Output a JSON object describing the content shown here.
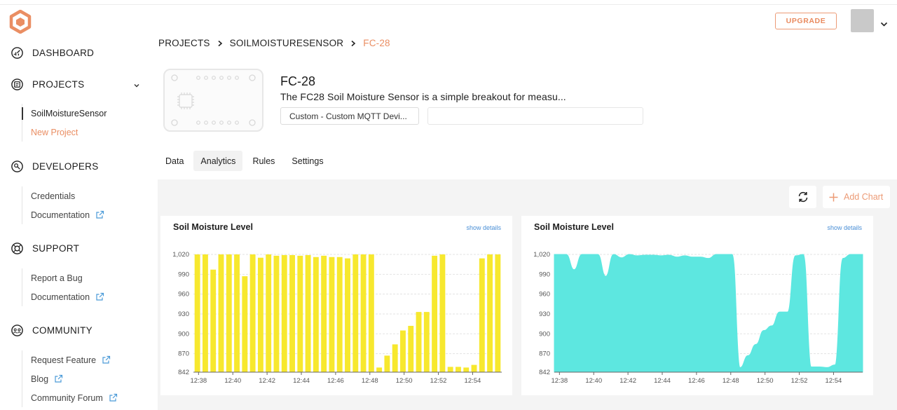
{
  "header": {
    "upgrade_label": "UPGRADE"
  },
  "sidebar": {
    "sections": [
      {
        "label": "DASHBOARD"
      },
      {
        "label": "PROJECTS",
        "items": [
          {
            "label": "SoilMoistureSensor"
          },
          {
            "label": "New Project"
          }
        ]
      },
      {
        "label": "DEVELOPERS",
        "items": [
          {
            "label": "Credentials"
          },
          {
            "label": "Documentation"
          }
        ]
      },
      {
        "label": "SUPPORT",
        "items": [
          {
            "label": "Report a Bug"
          },
          {
            "label": "Documentation"
          }
        ]
      },
      {
        "label": "COMMUNITY",
        "items": [
          {
            "label": "Request Feature"
          },
          {
            "label": "Blog"
          },
          {
            "label": "Community Forum"
          }
        ]
      }
    ]
  },
  "breadcrumb": [
    "PROJECTS",
    "SOILMOISTURESENSOR",
    "FC-28"
  ],
  "device": {
    "title": "FC-28",
    "description": "The FC28 Soil Moisture Sensor is a simple breakout for measu...",
    "type_tag": "Custom - Custom MQTT Devi..."
  },
  "tabs": [
    {
      "label": "Data"
    },
    {
      "label": "Analytics",
      "active": true
    },
    {
      "label": "Rules"
    },
    {
      "label": "Settings"
    }
  ],
  "toolbar": {
    "add_chart_label": "Add Chart"
  },
  "colors": {
    "accent": "#ea8e63",
    "bar": "#f7e82e",
    "area": "#5de7e0",
    "link": "#4a8fd6"
  },
  "chart_data": [
    {
      "type": "bar",
      "title": "Soil Moisture Level",
      "link_label": "show details",
      "ylim": [
        842,
        1020
      ],
      "yticks": [
        "842",
        "870",
        "900",
        "930",
        "960",
        "990",
        "1,020"
      ],
      "xticks": [
        "12:38",
        "12:40",
        "12:42",
        "12:44",
        "12:46",
        "12:48",
        "12:50",
        "12:52",
        "12:54"
      ],
      "values": [
        1020,
        1020,
        997,
        1020,
        1020,
        1020,
        987,
        1020,
        1015,
        1020,
        1018,
        1019,
        1019,
        1018,
        1019,
        1016,
        1018,
        1016,
        1016,
        1014,
        1020,
        1020,
        1020,
        849,
        867,
        884,
        905,
        912,
        933,
        933,
        1018,
        1020,
        850,
        850,
        849,
        853,
        1014,
        1020,
        1020
      ]
    },
    {
      "type": "area",
      "title": "Soil Moisture Level",
      "link_label": "show details",
      "ylim": [
        842,
        1020
      ],
      "yticks": [
        "842",
        "870",
        "900",
        "930",
        "960",
        "990",
        "1,020"
      ],
      "xticks": [
        "12:38",
        "12:40",
        "12:42",
        "12:44",
        "12:46",
        "12:48",
        "12:50",
        "12:52",
        "12:54"
      ],
      "values": [
        1020,
        1020,
        997,
        1020,
        1020,
        1020,
        987,
        1020,
        1015,
        1020,
        1018,
        1019,
        1019,
        1018,
        1019,
        1016,
        1018,
        1016,
        1016,
        1014,
        1020,
        1020,
        1020,
        849,
        867,
        884,
        905,
        912,
        933,
        933,
        1018,
        1020,
        850,
        850,
        849,
        853,
        1014,
        1020,
        1020
      ]
    }
  ]
}
